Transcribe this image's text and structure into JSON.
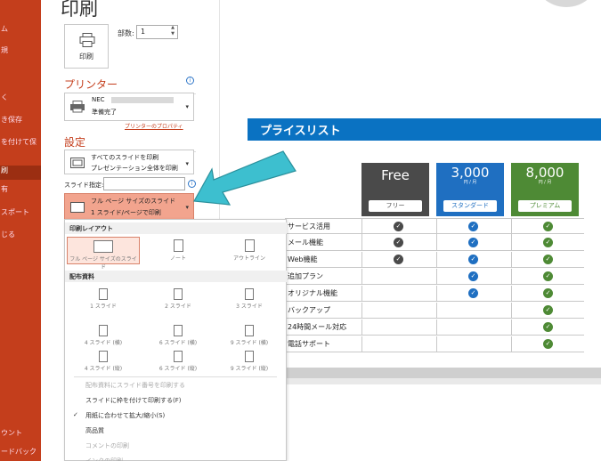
{
  "page": {
    "title": "印刷"
  },
  "rail": {
    "items": [
      {
        "label": "ム",
        "active": false
      },
      {
        "label": "規",
        "active": false
      },
      {
        "label": "",
        "active": false
      },
      {
        "label": "く",
        "active": false
      },
      {
        "label": "き保存",
        "active": false
      },
      {
        "label": "を付けて保",
        "active": false
      },
      {
        "label": "",
        "active": false
      },
      {
        "label": "刷",
        "active": true
      },
      {
        "label": "有",
        "active": false
      },
      {
        "label": "スポート",
        "active": false
      },
      {
        "label": "じる",
        "active": false
      },
      {
        "label": "ウント",
        "active": false
      },
      {
        "label": "ードバック",
        "active": false
      }
    ]
  },
  "print": {
    "button_label": "印刷",
    "copies_label": "部数:",
    "copies_value": "1"
  },
  "printer": {
    "section_title": "プリンター",
    "name_prefix": "NEC",
    "status": "準備完了",
    "properties_link": "プリンターのプロパティ"
  },
  "settings": {
    "section_title": "設定",
    "range_line1": "すべてのスライドを印刷",
    "range_line2": "プレゼンテーション全体を印刷",
    "slide_spec_label": "スライド指定:",
    "layout_line1": "フル ページ サイズのスライド",
    "layout_line2": "1 スライド/ページで印刷"
  },
  "menu": {
    "layout_header": "印刷レイアウト",
    "layout_options": [
      "フル ページ サイズのスライド",
      "ノート",
      "アウトライン"
    ],
    "handouts_header": "配布資料",
    "handouts": [
      "1 スライド",
      "2 スライド",
      "3 スライド",
      "4 スライド (横)",
      "6 スライド (横)",
      "9 スライド (横)",
      "4 スライド (縦)",
      "6 スライド (縦)",
      "9 スライド (縦)"
    ],
    "extra": [
      {
        "label": "配布資料にスライド番号を印刷する",
        "disabled": true,
        "checked": false
      },
      {
        "label": "スライドに枠を付けて印刷する(F)",
        "disabled": false,
        "checked": false
      },
      {
        "label": "用紙に合わせて拡大/縮小(S)",
        "disabled": false,
        "checked": true
      },
      {
        "label": "高品質",
        "disabled": false,
        "checked": false
      },
      {
        "label": "コメントの印刷",
        "disabled": true,
        "checked": false
      },
      {
        "label": "インクの印刷",
        "disabled": true,
        "checked": false
      }
    ]
  },
  "slide": {
    "banner_title": "プライスリスト",
    "plans": [
      {
        "name": "Free",
        "price": "",
        "unit": "",
        "tag": "フリー",
        "color": "#4a4a4a"
      },
      {
        "name": "",
        "price": "3,000",
        "unit": "円 / 月",
        "tag": "スタンダード",
        "color": "#1f6fc1"
      },
      {
        "name": "",
        "price": "8,000",
        "unit": "円 / 月",
        "tag": "プレミアム",
        "color": "#4e8a35"
      }
    ],
    "features": [
      {
        "label": "サービス活用",
        "free": true,
        "standard": true,
        "premium": true
      },
      {
        "label": "メール機能",
        "free": true,
        "standard": true,
        "premium": true
      },
      {
        "label": "Web機能",
        "free": true,
        "standard": true,
        "premium": true
      },
      {
        "label": "追加プラン",
        "free": false,
        "standard": true,
        "premium": true
      },
      {
        "label": "オリジナル機能",
        "free": false,
        "standard": true,
        "premium": true
      },
      {
        "label": "バックアップ",
        "free": false,
        "standard": false,
        "premium": true
      },
      {
        "label": "24時間メール対応",
        "free": false,
        "standard": false,
        "premium": true
      },
      {
        "label": "電話サポート",
        "free": false,
        "standard": false,
        "premium": true
      }
    ]
  },
  "colors": {
    "accent": "#c43e1c",
    "arrow": "#3dbfcf",
    "banner": "#0a72c2",
    "check_dark": "#4a4a4a",
    "check_blue": "#1f6fc1",
    "check_green": "#4e8a35"
  }
}
